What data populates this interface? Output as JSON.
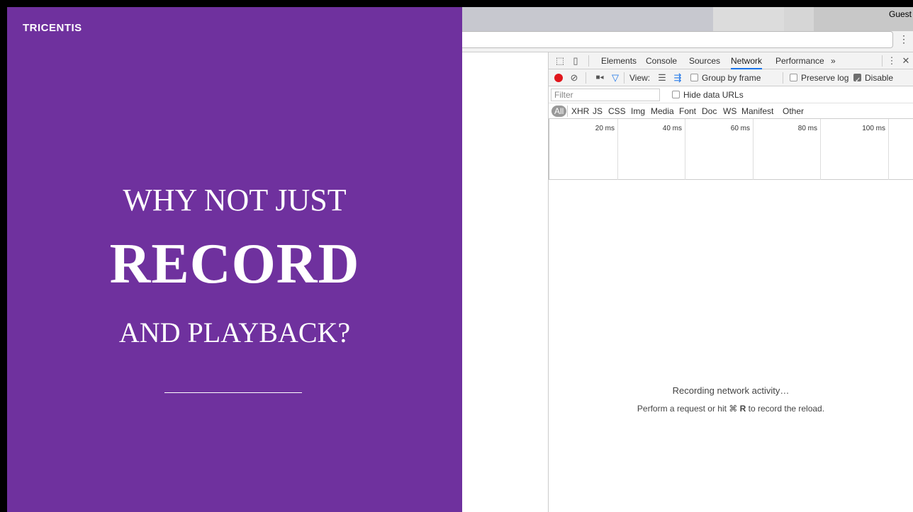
{
  "slide": {
    "brand": "TRICENTIS",
    "line1": "WHY NOT JUST",
    "line2": "RECORD",
    "line3": "AND PLAYBACK?",
    "background_color": "#6f319e"
  },
  "browser": {
    "profile_label": "Guest",
    "menu_icon": "vertical-dots-icon"
  },
  "devtools": {
    "tabs": [
      "Elements",
      "Console",
      "Sources",
      "Network",
      "Performance",
      "»"
    ],
    "active_tab": "Network",
    "toolbar": {
      "view_label": "View:",
      "group_by_frame": "Group by frame",
      "preserve_log": "Preserve log",
      "disable_cache": "Disable cache",
      "disable_cache_checked": true
    },
    "filter": {
      "placeholder": "Filter",
      "hide_data_urls": "Hide data URLs"
    },
    "types": [
      "All",
      "XHR",
      "JS",
      "CSS",
      "Img",
      "Media",
      "Font",
      "Doc",
      "WS",
      "Manifest",
      "Other"
    ],
    "timeline_ticks": [
      "20 ms",
      "40 ms",
      "60 ms",
      "80 ms",
      "100 ms"
    ],
    "status_line1": "Recording network activity…",
    "status_line2_prefix": "Perform a request or hit ⌘",
    "status_line2_key": "R",
    "status_line2_suffix": "to record the reload.",
    "record_color": "#e0161c"
  }
}
